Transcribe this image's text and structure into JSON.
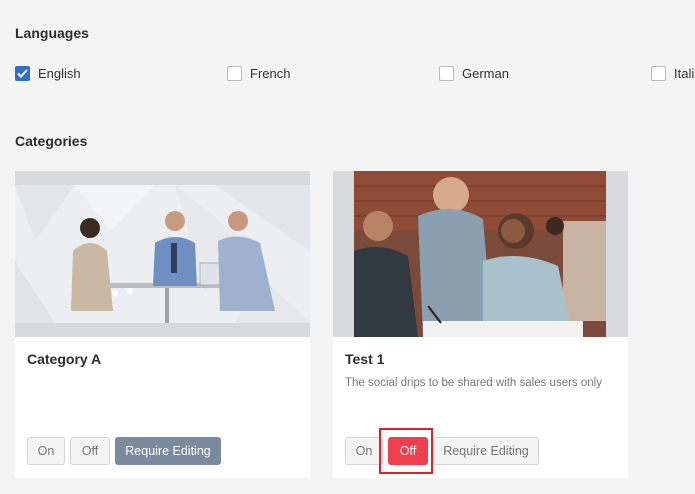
{
  "languages": {
    "title": "Languages",
    "items": [
      {
        "label": "English",
        "checked": true
      },
      {
        "label": "French",
        "checked": false
      },
      {
        "label": "German",
        "checked": false
      },
      {
        "label": "Itali",
        "checked": false
      }
    ]
  },
  "categories": {
    "title": "Categories",
    "cards": [
      {
        "title": "Category A",
        "description": "",
        "buttons": {
          "on": "On",
          "off": "Off",
          "require_editing": "Require Editing"
        },
        "selected": "require_editing"
      },
      {
        "title": "Test 1",
        "description": "The social drips to be shared with sales users only",
        "buttons": {
          "on": "On",
          "off": "Off",
          "require_editing": "Require Editing"
        },
        "selected": "off"
      }
    ]
  },
  "colors": {
    "checkbox_checked": "#2f6fc9",
    "require_editing_active": "#7b8a9e",
    "off_active": "#ef3e4c",
    "highlight_border": "#e0202c"
  }
}
